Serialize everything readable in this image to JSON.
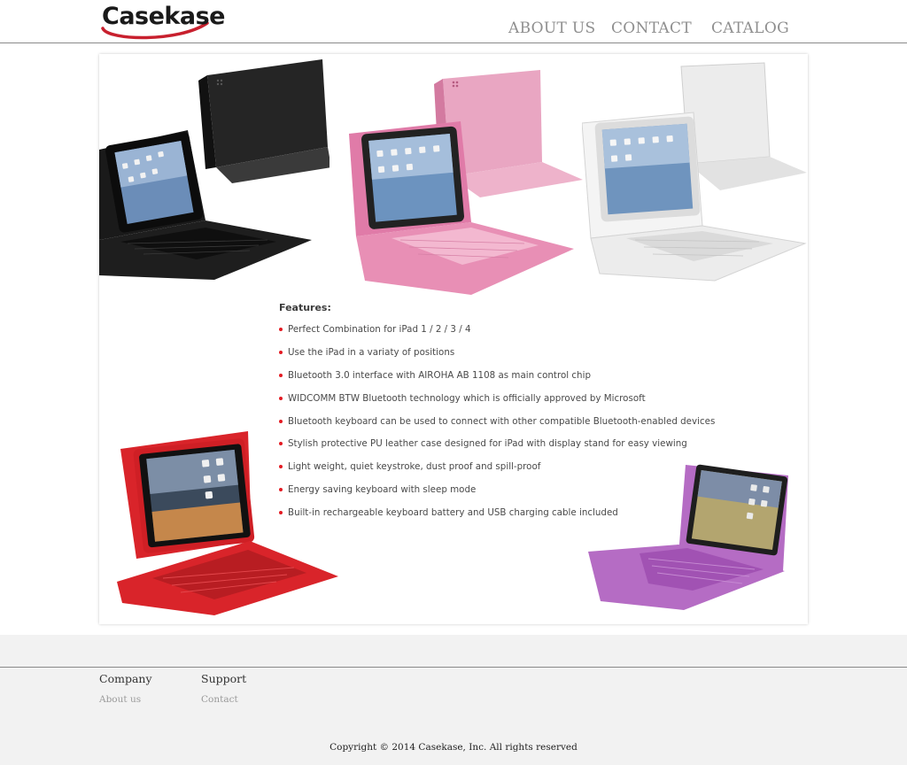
{
  "brand": {
    "name": "Casekase",
    "accent": "#c8202e"
  },
  "nav": {
    "items": [
      {
        "label": "ABOUT US"
      },
      {
        "label": "CONTACT"
      },
      {
        "label": "CATALOG"
      }
    ]
  },
  "product_images": [
    {
      "color": "black",
      "hex": "#1f1f1f"
    },
    {
      "color": "pink",
      "hex": "#e88fb5"
    },
    {
      "color": "white",
      "hex": "#ececec"
    },
    {
      "color": "red",
      "hex": "#d9242a"
    },
    {
      "color": "purple",
      "hex": "#b56cc4"
    }
  ],
  "features": {
    "title": "Features:",
    "items": [
      "Perfect Combination for iPad 1 / 2 / 3 / 4",
      "Use the iPad in a variaty of positions",
      "Bluetooth 3.0 interface with AIROHA AB 1108 as main control chip",
      "WIDCOMM BTW Bluetooth technology which is officially approved by Microsoft",
      "Bluetooth keyboard can be used to connect with other compatible Bluetooth-enabled devices",
      "Stylish protective PU leather case designed for iPad with display stand for easy viewing",
      "Light weight, quiet keystroke, dust proof and spill-proof",
      "Energy saving keyboard with sleep mode",
      "Built-in rechargeable keyboard battery and USB charging cable included"
    ],
    "bullet_color": "#e31b23"
  },
  "footer": {
    "company": {
      "heading": "Company",
      "link": "About us"
    },
    "support": {
      "heading": "Support",
      "link": "Contact"
    },
    "copyright": "Copyright © 2014 Casekase, Inc. All rights reserved"
  }
}
